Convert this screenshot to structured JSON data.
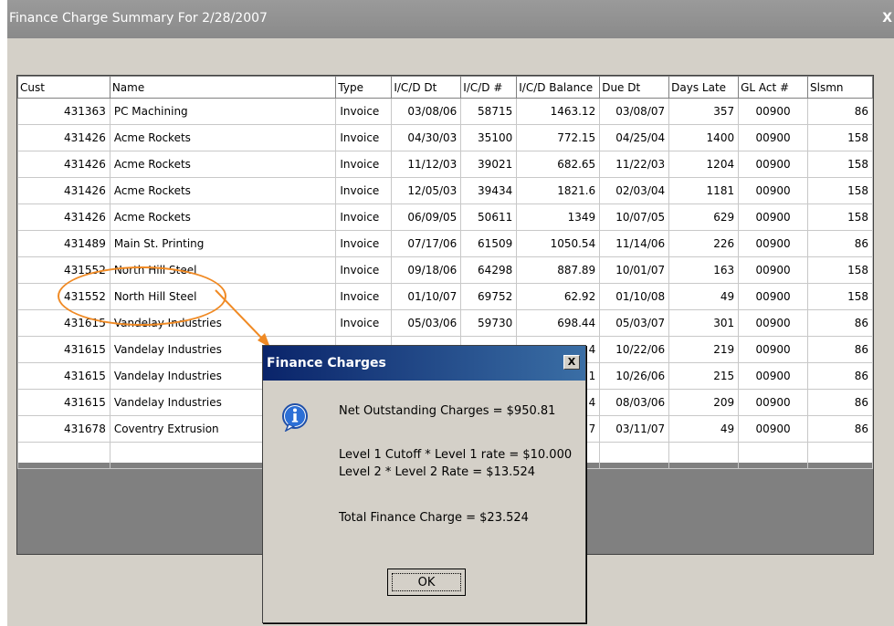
{
  "window": {
    "title": "Finance Charge Summary For 2/28/2007",
    "close_label": "X"
  },
  "grid": {
    "columns": [
      "Cust",
      "Name",
      "Type",
      "I/C/D Dt",
      "I/C/D #",
      "I/C/D Balance",
      "Due Dt",
      "Days Late",
      "GL Act #",
      "Slsmn"
    ],
    "rows": [
      [
        "431363",
        "PC Machining",
        "Invoice",
        "03/08/06",
        "58715",
        "1463.12",
        "03/08/07",
        "357",
        "00900",
        "86"
      ],
      [
        "431426",
        "Acme Rockets",
        "Invoice",
        "04/30/03",
        "35100",
        "772.15",
        "04/25/04",
        "1400",
        "00900",
        "158"
      ],
      [
        "431426",
        "Acme Rockets",
        "Invoice",
        "11/12/03",
        "39021",
        "682.65",
        "11/22/03",
        "1204",
        "00900",
        "158"
      ],
      [
        "431426",
        "Acme Rockets",
        "Invoice",
        "12/05/03",
        "39434",
        "1821.6",
        "02/03/04",
        "1181",
        "00900",
        "158"
      ],
      [
        "431426",
        "Acme Rockets",
        "Invoice",
        "06/09/05",
        "50611",
        "1349",
        "10/07/05",
        "629",
        "00900",
        "158"
      ],
      [
        "431489",
        "Main St. Printing",
        "Invoice",
        "07/17/06",
        "61509",
        "1050.54",
        "11/14/06",
        "226",
        "00900",
        "86"
      ],
      [
        "431552",
        "North Hill Steel",
        "Invoice",
        "09/18/06",
        "64298",
        "887.89",
        "10/01/07",
        "163",
        "00900",
        "158"
      ],
      [
        "431552",
        "North Hill Steel",
        "Invoice",
        "01/10/07",
        "69752",
        "62.92",
        "01/10/08",
        "49",
        "00900",
        "158"
      ],
      [
        "431615",
        "Vandelay Industries",
        "Invoice",
        "05/03/06",
        "59730",
        "698.44",
        "05/03/07",
        "301",
        "00900",
        "86"
      ],
      [
        "431615",
        "Vandelay Industries",
        "",
        "",
        "",
        "4",
        "10/22/06",
        "219",
        "00900",
        "86"
      ],
      [
        "431615",
        "Vandelay Industries",
        "",
        "",
        "",
        "1",
        "10/26/06",
        "215",
        "00900",
        "86"
      ],
      [
        "431615",
        "Vandelay Industries",
        "",
        "",
        "",
        "4",
        "08/03/06",
        "209",
        "00900",
        "86"
      ],
      [
        "431678",
        "Coventry Extrusion",
        "",
        "",
        "",
        "7",
        "03/11/07",
        "49",
        "00900",
        "86"
      ],
      [
        "",
        "",
        "",
        "",
        "",
        "",
        "",
        "",
        "",
        ""
      ]
    ]
  },
  "dialog": {
    "title": "Finance Charges",
    "close_label": "X",
    "icon": "info-icon",
    "lines": [
      "Net Outstanding Charges = $950.81",
      "Level 1 Cutoff * Level 1 rate = $10.000",
      "Level 2 * Level 2 Rate = $13.524",
      "Total Finance Charge = $23.524"
    ],
    "ok_label": "OK"
  },
  "colors": {
    "annotation": "#f08a24",
    "dialog_title": "#0a246a",
    "window_title": "#8a8a8a"
  }
}
